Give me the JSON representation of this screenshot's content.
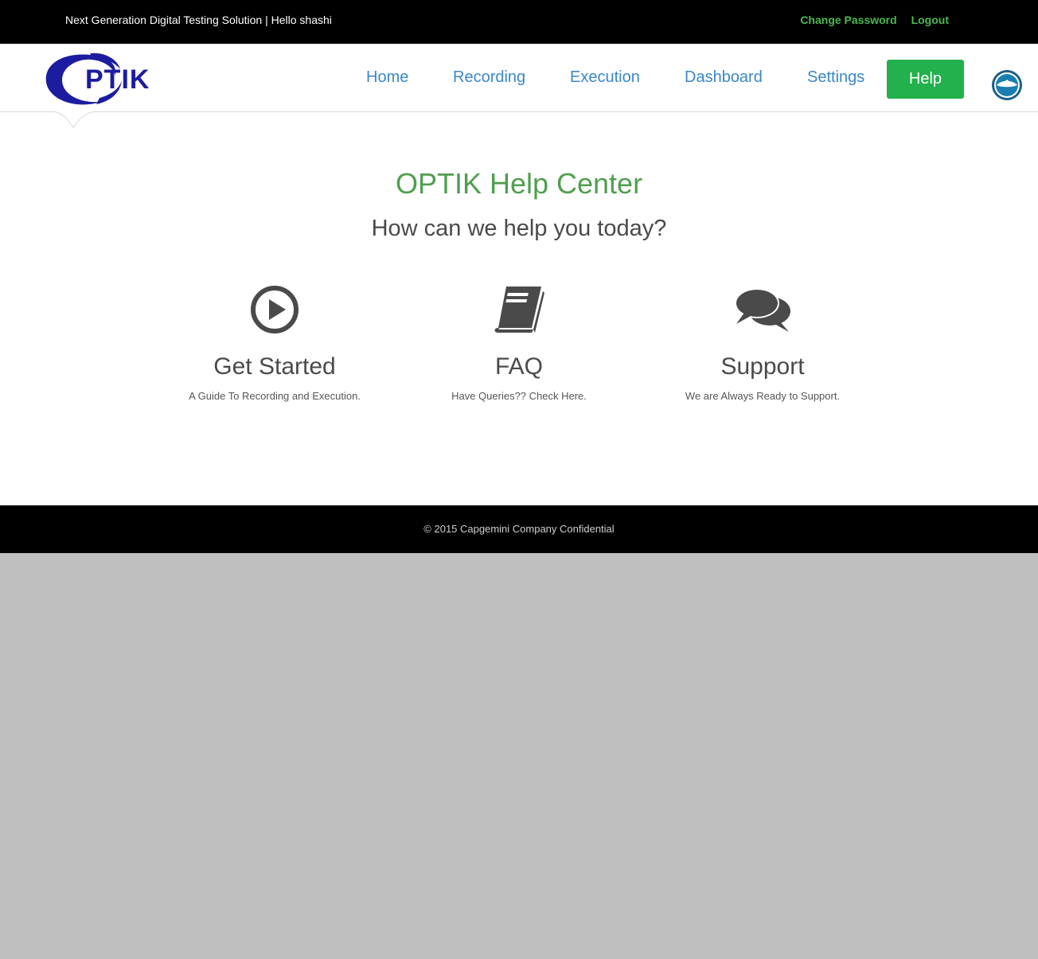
{
  "topbar": {
    "tagline": "Next Generation Digital Testing Solution | Hello shashi",
    "change_password": "Change Password",
    "logout": "Logout"
  },
  "logo": {
    "text": "PTIK",
    "brand_color": "#1c1ca0"
  },
  "nav": {
    "items": [
      {
        "label": "Home"
      },
      {
        "label": "Recording"
      },
      {
        "label": "Execution"
      },
      {
        "label": "Dashboard"
      },
      {
        "label": "Settings"
      }
    ],
    "help": "Help",
    "link_color": "#3a87c9",
    "help_color": "#22b14c"
  },
  "main": {
    "title": "OPTIK Help Center",
    "subtitle": "How can we help you today?",
    "cards": [
      {
        "icon": "play-circle-icon",
        "title": "Get Started",
        "description": "A Guide To Recording and Execution."
      },
      {
        "icon": "book-icon",
        "title": "FAQ",
        "description": "Have Queries?? Check Here."
      },
      {
        "icon": "chat-bubbles-icon",
        "title": "Support",
        "description": "We are Always Ready to Support."
      }
    ]
  },
  "footer": {
    "text": "© 2015 Capgemini Company Confidential"
  }
}
